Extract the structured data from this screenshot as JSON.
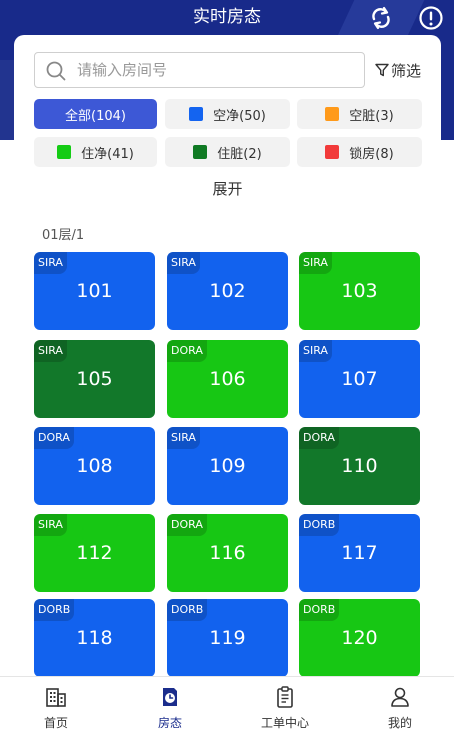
{
  "header": {
    "title": "实时房态"
  },
  "search": {
    "placeholder": "请输入房间号",
    "filter_label": "筛选"
  },
  "filters": [
    {
      "label": "全部(104)",
      "color": "",
      "active": true
    },
    {
      "label": "空净(50)",
      "color": "#1464f0",
      "active": false
    },
    {
      "label": "空脏(3)",
      "color": "#ff9a1a",
      "active": false
    },
    {
      "label": "住净(41)",
      "color": "#15cc15",
      "active": false
    },
    {
      "label": "住脏(2)",
      "color": "#107a24",
      "active": false
    },
    {
      "label": "锁房(8)",
      "color": "#f23a3a",
      "active": false
    }
  ],
  "expand_label": "展开",
  "floor_label": "01层/1",
  "colors": {
    "blue": "#1262ee",
    "green": "#17c714",
    "dark_green": "#12782a"
  },
  "rooms": [
    {
      "number": "101",
      "tag": "SIRA",
      "status": "blue"
    },
    {
      "number": "102",
      "tag": "SIRA",
      "status": "blue"
    },
    {
      "number": "103",
      "tag": "SIRA",
      "status": "green"
    },
    {
      "number": "105",
      "tag": "SIRA",
      "status": "dark_green"
    },
    {
      "number": "106",
      "tag": "DORA",
      "status": "green"
    },
    {
      "number": "107",
      "tag": "SIRA",
      "status": "blue"
    },
    {
      "number": "108",
      "tag": "DORA",
      "status": "blue"
    },
    {
      "number": "109",
      "tag": "SIRA",
      "status": "blue"
    },
    {
      "number": "110",
      "tag": "DORA",
      "status": "dark_green"
    },
    {
      "number": "112",
      "tag": "SIRA",
      "status": "green"
    },
    {
      "number": "116",
      "tag": "DORA",
      "status": "green"
    },
    {
      "number": "117",
      "tag": "DORB",
      "status": "blue"
    },
    {
      "number": "118",
      "tag": "DORB",
      "status": "blue"
    },
    {
      "number": "119",
      "tag": "DORB",
      "status": "blue"
    },
    {
      "number": "120",
      "tag": "DORB",
      "status": "green"
    }
  ],
  "nav": [
    {
      "label": "首页",
      "icon": "building-icon",
      "active": false
    },
    {
      "label": "房态",
      "icon": "room-status-icon",
      "active": true
    },
    {
      "label": "工单中心",
      "icon": "clipboard-icon",
      "active": false
    },
    {
      "label": "我的",
      "icon": "user-icon",
      "active": false
    }
  ]
}
